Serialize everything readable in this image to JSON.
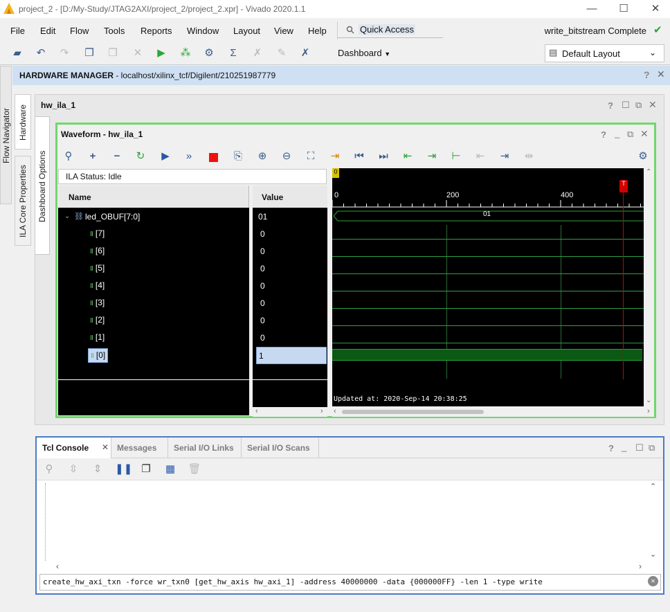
{
  "window": {
    "title": "project_2 - [D:/My-Study/JTAG2AXI/project_2/project_2.xpr] - Vivado 2020.1.1",
    "min": "—",
    "max": "☐",
    "close": "✕"
  },
  "menu": [
    "File",
    "Edit",
    "Flow",
    "Tools",
    "Reports",
    "Window",
    "Layout",
    "View",
    "Help"
  ],
  "quick_access": "Quick Access",
  "status_text": "write_bitstream Complete",
  "toolbar": {
    "dashboard": "Dashboard",
    "layout": "Default Layout"
  },
  "left_tabs": {
    "flow_nav": "Flow Navigator",
    "hardware": "Hardware",
    "ila_props": "ILA Core Properties",
    "dash_opts": "Dashboard Options"
  },
  "hm": {
    "label": "HARDWARE MANAGER",
    "path": " - localhost/xilinx_tcf/Digilent/210251987779"
  },
  "ila": {
    "tab": "hw_ila_1"
  },
  "waveform": {
    "title": "Waveform - hw_ila_1",
    "status": "ILA Status:  Idle",
    "name_header": "Name",
    "value_header": "Value",
    "bus": {
      "name": "led_OBUF[7:0]",
      "value": "01"
    },
    "signals": [
      {
        "name": "[7]",
        "value": "0"
      },
      {
        "name": "[6]",
        "value": "0"
      },
      {
        "name": "[5]",
        "value": "0"
      },
      {
        "name": "[4]",
        "value": "0"
      },
      {
        "name": "[3]",
        "value": "0"
      },
      {
        "name": "[2]",
        "value": "0"
      },
      {
        "name": "[1]",
        "value": "0"
      },
      {
        "name": "[0]",
        "value": "1"
      }
    ],
    "ticks": [
      "0",
      "200",
      "400"
    ],
    "marker0": "0",
    "trigger": "T",
    "bus_wave_label": "01",
    "updated": "Updated at: 2020-Sep-14 20:38:25"
  },
  "console": {
    "tabs": [
      "Tcl Console",
      "Messages",
      "Serial I/O Links",
      "Serial I/O Scans"
    ],
    "command": "create_hw_axi_txn -force wr_txn0 [get_hw_axis hw_axi_1] -address 40000000 -data {000000FF} -len 1 -type write"
  },
  "colors": {
    "accent": "#4b7bc6",
    "wave": "#2ea043",
    "waveform_border": "#72d66b",
    "trigger": "#d00000"
  }
}
